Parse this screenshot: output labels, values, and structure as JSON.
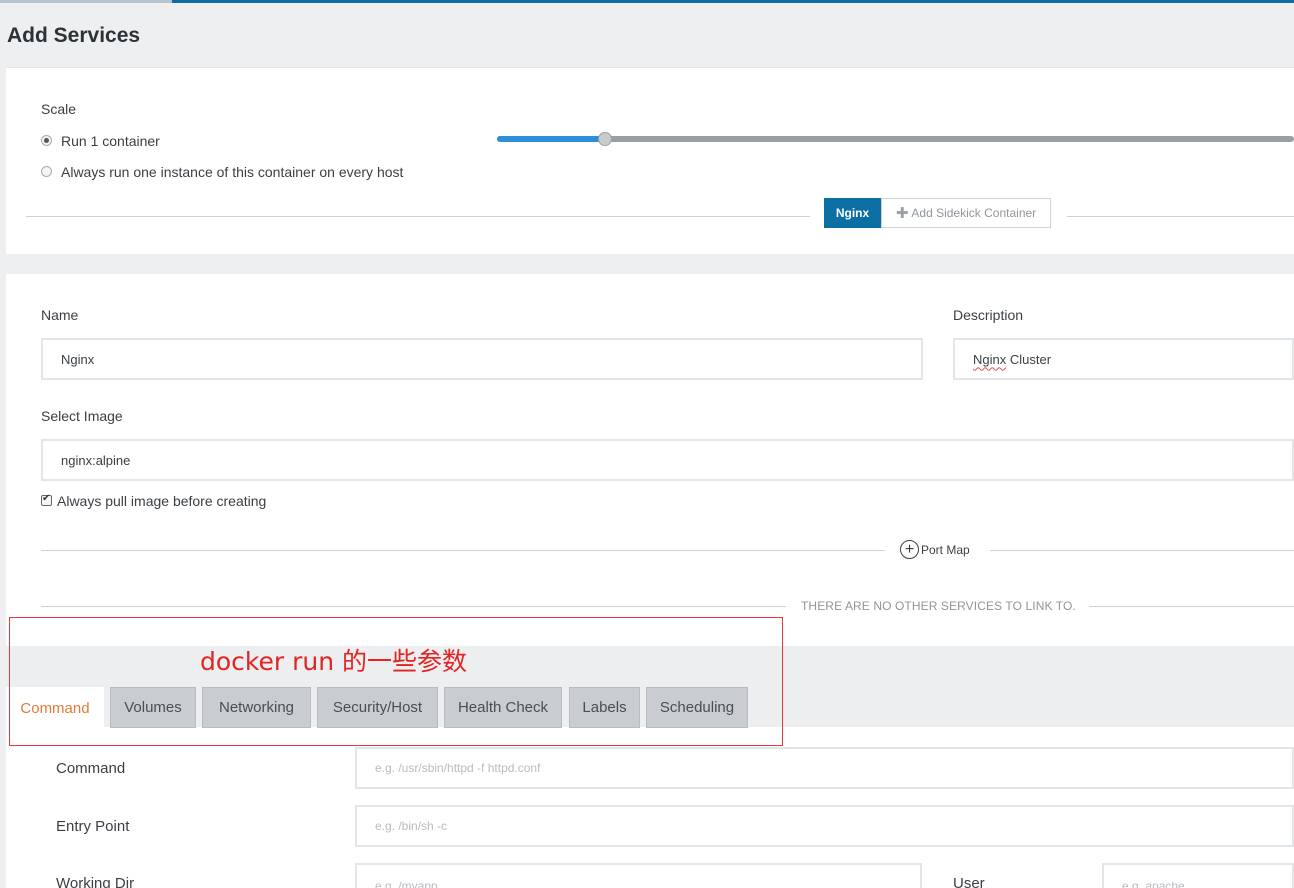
{
  "page": {
    "title": "Add Services"
  },
  "scale": {
    "label": "Scale",
    "option_run": "Run 1 container",
    "option_always": "Always run one instance of this container on every host",
    "slider_value_fraction": 0.136
  },
  "containers": {
    "active_tab": "Nginx",
    "add_sidekick": "Add Sidekick Container"
  },
  "form": {
    "name_label": "Name",
    "name_value": "Nginx",
    "description_label": "Description",
    "description_value_word1": "Nginx",
    "description_value_word2": " Cluster",
    "image_label": "Select Image",
    "image_value": "nginx:alpine",
    "always_pull_label": "Always pull image before creating",
    "port_map": "Port Map",
    "no_link": "THERE ARE NO OTHER SERVICES TO LINK TO."
  },
  "annotation": {
    "text": "docker run 的一些参数"
  },
  "tabs": [
    "Command",
    "Volumes",
    "Networking",
    "Security/Host",
    "Health Check",
    "Labels",
    "Scheduling"
  ],
  "command_tab": {
    "command_label": "Command",
    "command_placeholder": "e.g. /usr/sbin/httpd -f httpd.conf",
    "entry_label": "Entry Point",
    "entry_placeholder": "e.g. /bin/sh -c",
    "workdir_label": "Working Dir",
    "workdir_placeholder": "e.g. /myapp",
    "user_label": "User",
    "user_placeholder": "e.g. apache"
  },
  "colors": {
    "accent_blue": "#0b6fa4",
    "slider_blue": "#2d8fd7",
    "tab_active_text": "#e07b39",
    "annotation_red": "#e42323"
  }
}
